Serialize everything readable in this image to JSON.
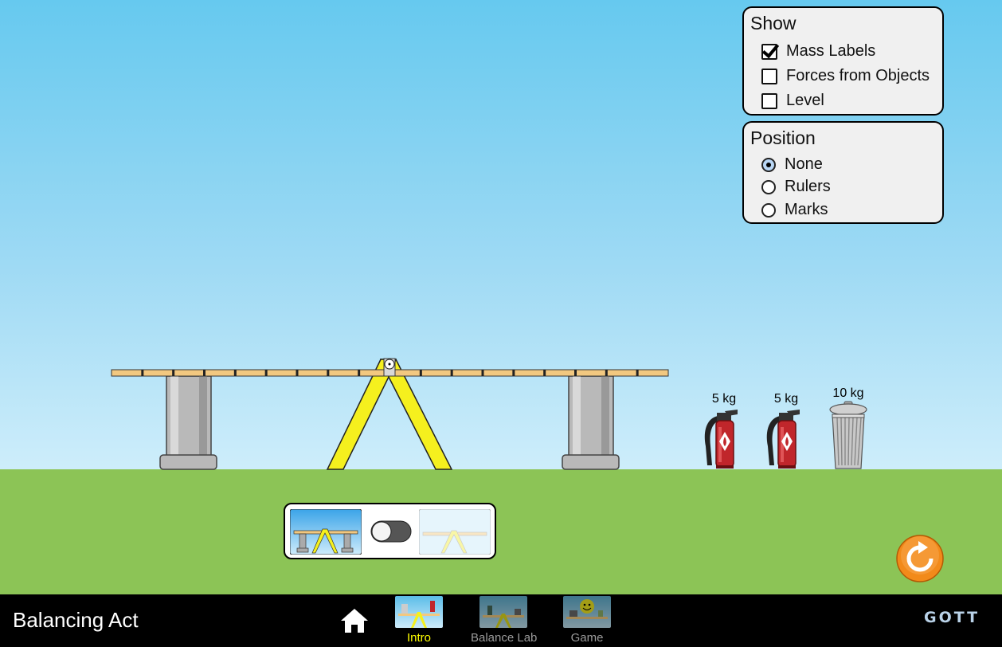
{
  "app": {
    "title": "Balancing Act",
    "brand": "GOTT"
  },
  "show_panel": {
    "title": "Show",
    "options": [
      {
        "label": "Mass Labels",
        "checked": true
      },
      {
        "label": "Forces from Objects",
        "checked": false
      },
      {
        "label": "Level",
        "checked": false
      }
    ]
  },
  "position_panel": {
    "title": "Position",
    "options": [
      {
        "label": "None",
        "selected": true
      },
      {
        "label": "Rulers",
        "selected": false
      },
      {
        "label": "Marks",
        "selected": false
      }
    ]
  },
  "objects": [
    {
      "name": "fire-extinguisher",
      "mass_label": "5 kg"
    },
    {
      "name": "fire-extinguisher",
      "mass_label": "5 kg"
    },
    {
      "name": "trash-can",
      "mass_label": "10 kg"
    }
  ],
  "supports_toggle": {
    "state": "supports-on"
  },
  "nav": {
    "tabs": [
      {
        "label": "Intro",
        "active": true
      },
      {
        "label": "Balance Lab",
        "active": false
      },
      {
        "label": "Game",
        "active": false
      }
    ]
  },
  "colors": {
    "sky": "#66c9ef",
    "ground": "#8cc456",
    "plank": "#f2c880",
    "fulcrum": "#f5f01e",
    "active_tab": "#ffff00",
    "inactive_tab": "#9a9a9a",
    "reset": "#f28a1a"
  }
}
